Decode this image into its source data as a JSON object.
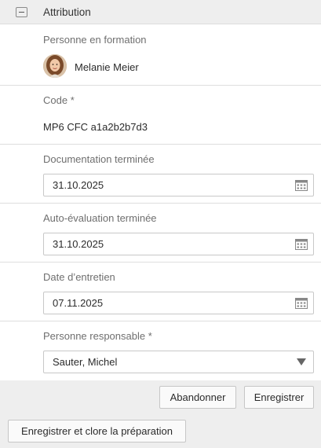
{
  "header": {
    "title": "Attribution"
  },
  "trainee": {
    "label": "Personne en formation",
    "name": "Melanie Meier"
  },
  "code": {
    "label": "Code *",
    "value": "MP6 CFC a1a2b2b7d3"
  },
  "documentation": {
    "label": "Documentation terminée",
    "value": "31.10.2025"
  },
  "self_assessment": {
    "label": "Auto-évaluation terminée",
    "value": "31.10.2025"
  },
  "interview_date": {
    "label": "Date d’entretien",
    "value": "07.11.2025"
  },
  "responsible": {
    "label": "Personne responsable *",
    "value": "Sauter, Michel"
  },
  "buttons": {
    "cancel": "Abandonner",
    "save": "Enregistrer",
    "save_close": "Enregistrer et clore la préparation"
  },
  "icons": {
    "collapse": "collapse-minus-icon",
    "calendar": "calendar-icon",
    "dropdown": "triangle-down-icon"
  },
  "colors": {
    "header_bg": "#eeeeee",
    "footer_bg": "#eeeeee",
    "label_text": "#6f6f6f",
    "border": "#c8c8c8"
  }
}
